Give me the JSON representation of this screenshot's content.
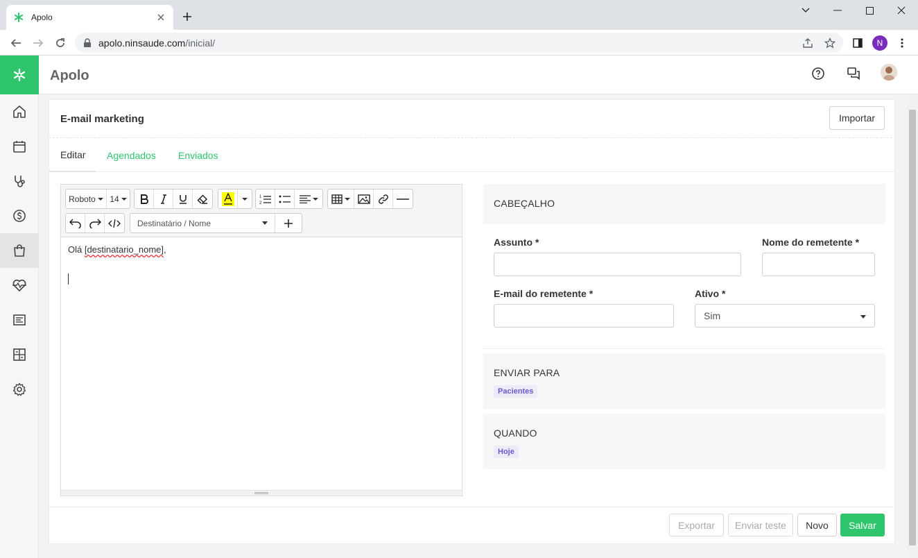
{
  "browser": {
    "tab_title": "Apolo",
    "url_domain": "apolo.ninsaude.com",
    "url_path": "/inicial/",
    "profile_initial": "N"
  },
  "app": {
    "title": "Apolo",
    "accent_color": "#2ec56c"
  },
  "sidebar": {
    "items": [
      {
        "icon": "home-icon"
      },
      {
        "icon": "calendar-icon"
      },
      {
        "icon": "stethoscope-icon"
      },
      {
        "icon": "dollar-icon"
      },
      {
        "icon": "shopping-bag-icon",
        "active": true
      },
      {
        "icon": "heart-pulse-icon"
      },
      {
        "icon": "report-icon"
      },
      {
        "icon": "grid-icon"
      },
      {
        "icon": "gear-icon"
      }
    ]
  },
  "page": {
    "title": "E-mail marketing",
    "import_label": "Importar",
    "tabs": [
      "Editar",
      "Agendados",
      "Enviados"
    ]
  },
  "editor": {
    "font_name": "Roboto",
    "font_size": "14",
    "variable_placeholder": "Destinatário / Nome",
    "content_prefix": "Olá ",
    "content_variable": "[destinatario_nome]",
    "content_suffix": ","
  },
  "header_section": {
    "title": "CABEÇALHO",
    "subject_label": "Assunto *",
    "sender_name_label": "Nome do remetente *",
    "sender_email_label": "E-mail do remetente *",
    "active_label": "Ativo *",
    "active_value": "Sim"
  },
  "send_to": {
    "title": "ENVIAR PARA",
    "chip": "Pacientes"
  },
  "when": {
    "title": "QUANDO",
    "chip": "Hoje"
  },
  "footer": {
    "export_label": "Exportar",
    "send_test_label": "Enviar teste",
    "new_label": "Novo",
    "save_label": "Salvar"
  }
}
